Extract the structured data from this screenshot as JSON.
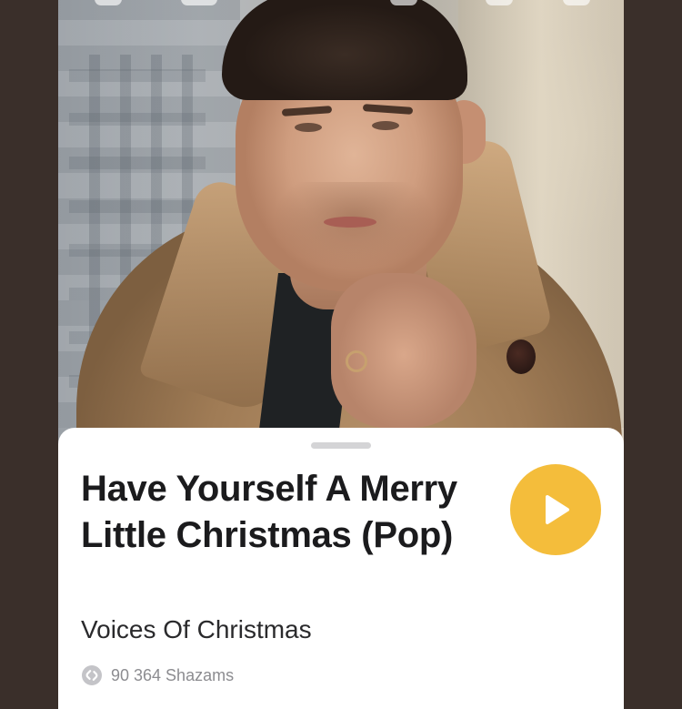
{
  "track": {
    "title": "Have Yourself A Merry Little Christmas (Pop)",
    "artist": "Voices Of Christmas",
    "shazam_count": "90 364 Shazams"
  },
  "icons": {
    "play": "play-icon",
    "shazam": "shazam-logo-icon"
  },
  "colors": {
    "play_button": "#f4bd3b",
    "backdrop": "#3a2f2a",
    "sheet": "#ffffff"
  }
}
